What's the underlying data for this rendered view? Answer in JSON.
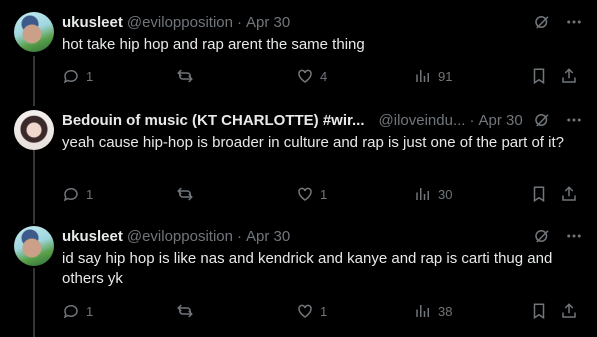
{
  "tweets": [
    {
      "name": "ukusleet",
      "handle": "@evilopposition",
      "dot": "·",
      "date": "Apr 30",
      "text": "hot take hip hop and rap arent the same thing",
      "replies": "1",
      "retweets": "",
      "likes": "4",
      "views": "91"
    },
    {
      "name": "Bedouin of music (KT CHARLOTTE) #wir...",
      "handle": "@iloveindu...",
      "dot": "·",
      "date": "Apr 30",
      "text": "yeah cause hip-hop is broader in culture and rap is just one of the part of it?",
      "replies": "1",
      "retweets": "",
      "likes": "1",
      "views": "30"
    },
    {
      "name": "ukusleet",
      "handle": "@evilopposition",
      "dot": "·",
      "date": "Apr 30",
      "text": "id say hip hop is like nas and kendrick and kanye and rap is carti thug and others yk",
      "replies": "1",
      "retweets": "",
      "likes": "1",
      "views": "38"
    }
  ],
  "icons": {
    "grok": "grok-icon",
    "more": "more-icon",
    "reply": "reply-icon",
    "retweet": "retweet-icon",
    "like": "like-icon",
    "views": "views-icon",
    "bookmark": "bookmark-icon",
    "share": "share-icon"
  },
  "colors": {
    "background": "#000000",
    "text": "#e7e9ea",
    "muted": "#71767b",
    "thread": "#333639"
  }
}
